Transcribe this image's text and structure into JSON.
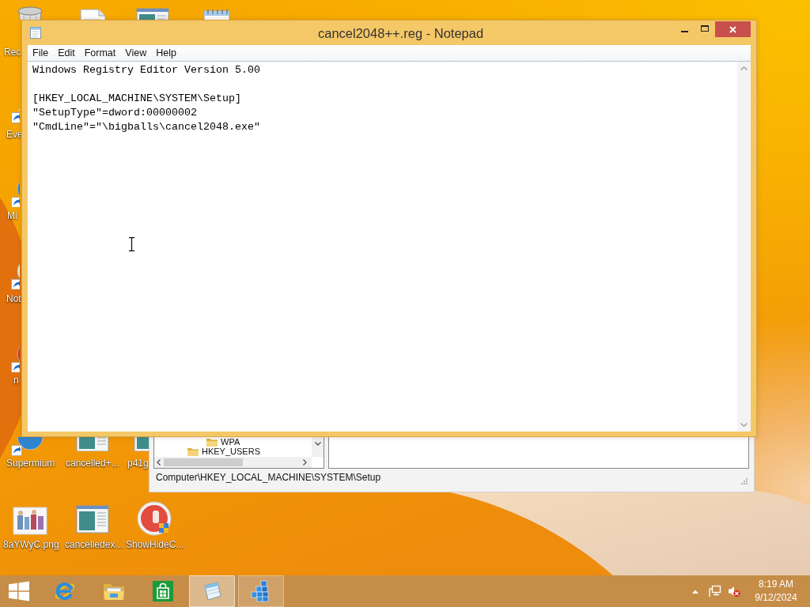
{
  "desktop": {
    "icons": [
      {
        "kind": "recycle-bin",
        "label": "Rec"
      },
      {
        "kind": "document"
      },
      {
        "kind": "window"
      },
      {
        "kind": "notepad"
      },
      {
        "kind": "shortcut",
        "label": "Eve"
      },
      {
        "kind": "shortcut",
        "label": "Mi"
      },
      {
        "kind": "shortcut",
        "label": "Not"
      },
      {
        "kind": "shortcut",
        "label": "n"
      },
      {
        "kind": "shortcut",
        "label": "Supermium"
      },
      {
        "kind": "window",
        "label": "cancelled+..."
      },
      {
        "kind": "window",
        "label": "p41g"
      },
      {
        "kind": "image",
        "label": "8aYWyC.png"
      },
      {
        "kind": "window",
        "label": "cancelledex..."
      },
      {
        "kind": "disc",
        "label": "ShowHideC..."
      }
    ]
  },
  "notepad": {
    "title": "cancel2048++.reg - Notepad",
    "menu": [
      "File",
      "Edit",
      "Format",
      "View",
      "Help"
    ],
    "blocks": [
      [
        "Windows Registry Editor Version 5.00"
      ],
      [
        "[HKEY_LOCAL_MACHINE\\SYSTEM\\Setup]",
        "\"SetupType\"=dword:00000002",
        "\"CmdLine\"=\"\\bigballs\\cancel2048.exe\""
      ]
    ]
  },
  "regedit": {
    "tree": [
      {
        "children": [
          {
            "label": "WPA"
          }
        ]
      },
      {
        "label": "HKEY_USERS"
      }
    ],
    "status_bar": "Computer\\HKEY_LOCAL_MACHINE\\SYSTEM\\Setup"
  },
  "taskbar": {
    "apps": [
      {
        "kind": "start"
      },
      {
        "kind": "browser",
        "running": false,
        "selected": false
      },
      {
        "kind": "folder",
        "running": false,
        "selected": false
      },
      {
        "kind": "store",
        "running": false,
        "selected": false
      },
      {
        "kind": "notepad",
        "running": true,
        "selected": true
      },
      {
        "kind": "registry",
        "running": true,
        "selected": false
      }
    ],
    "time": "8:19 AM",
    "date": "9/12/2024"
  }
}
